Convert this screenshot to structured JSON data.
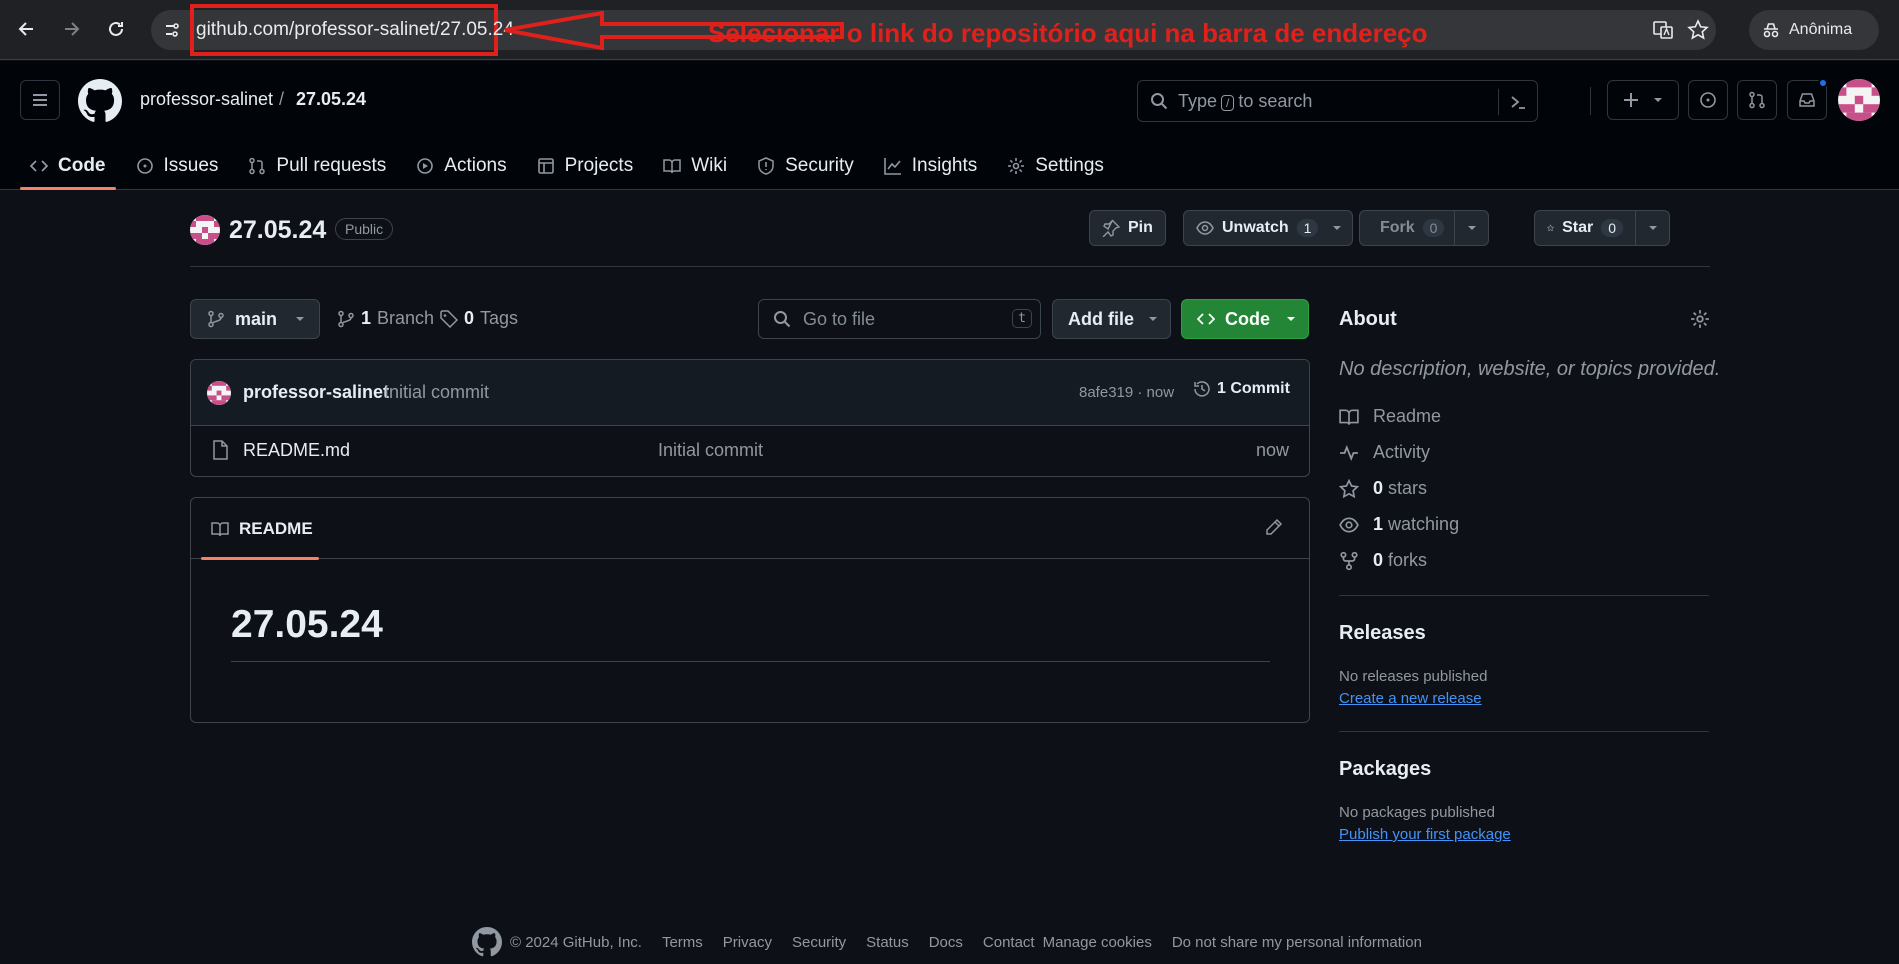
{
  "browser": {
    "url": "github.com/professor-salinet/27.05.24",
    "annotation": "Selecionar o link do repositório aqui na barra de endereço",
    "profile": "Anônima"
  },
  "header": {
    "owner": "professor-salinet",
    "separator": "/",
    "repo": "27.05.24",
    "search_prefix": "Type",
    "search_slash": "/",
    "search_suffix": "to search"
  },
  "tabs": [
    {
      "label": "Code"
    },
    {
      "label": "Issues"
    },
    {
      "label": "Pull requests"
    },
    {
      "label": "Actions"
    },
    {
      "label": "Projects"
    },
    {
      "label": "Wiki"
    },
    {
      "label": "Security"
    },
    {
      "label": "Insights"
    },
    {
      "label": "Settings"
    }
  ],
  "repo": {
    "name": "27.05.24",
    "visibility": "Public",
    "pin": "Pin",
    "unwatch": "Unwatch",
    "unwatch_count": "1",
    "fork": "Fork",
    "fork_count": "0",
    "star": "Star",
    "star_count": "0"
  },
  "toolbar": {
    "branch": "main",
    "branches_count": "1",
    "branches_label": "Branch",
    "tags_count": "0",
    "tags_label": "Tags",
    "goto_placeholder": "Go to file",
    "goto_kbd": "t",
    "add_file": "Add file",
    "code": "Code"
  },
  "commit": {
    "user": "professor-salinet",
    "message": "Initial commit",
    "hash_time": "8afe319 · now",
    "count": "1 Commit"
  },
  "files": [
    {
      "name": "README.md",
      "message": "Initial commit",
      "time": "now"
    }
  ],
  "readme": {
    "tab": "README",
    "heading": "27.05.24"
  },
  "about": {
    "title": "About",
    "description": "No description, website, or topics provided.",
    "readme": "Readme",
    "activity": "Activity",
    "stars_count": "0",
    "stars_label": "stars",
    "watching_count": "1",
    "watching_label": "watching",
    "forks_count": "0",
    "forks_label": "forks"
  },
  "releases": {
    "title": "Releases",
    "empty": "No releases published",
    "link": "Create a new release"
  },
  "packages": {
    "title": "Packages",
    "empty": "No packages published",
    "link": "Publish your first package"
  },
  "footer": {
    "copyright": "© 2024 GitHub, Inc.",
    "links": [
      "Terms",
      "Privacy",
      "Security",
      "Status",
      "Docs",
      "Contact",
      "Manage cookies",
      "Do not share my personal information"
    ]
  },
  "colors": {
    "annotation": "#e0211b",
    "primary_button": "#238636",
    "link": "#4493f8",
    "tab_underline": "#f78166"
  }
}
